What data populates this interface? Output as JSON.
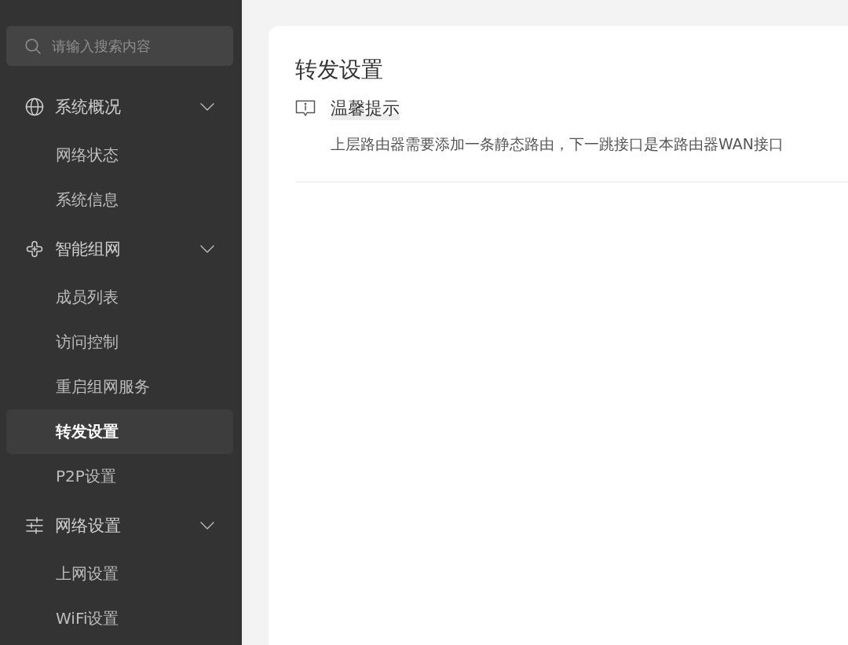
{
  "sidebar": {
    "search": {
      "placeholder": "请输入搜索内容"
    },
    "groups": [
      {
        "label": "系统概况",
        "expanded": true,
        "children": [
          {
            "label": "网络状态",
            "selected": false
          },
          {
            "label": "系统信息",
            "selected": false
          }
        ]
      },
      {
        "label": "智能组网",
        "expanded": true,
        "children": [
          {
            "label": "成员列表",
            "selected": false
          },
          {
            "label": "访问控制",
            "selected": false
          },
          {
            "label": "重启组网服务",
            "selected": false
          },
          {
            "label": "转发设置",
            "selected": true
          },
          {
            "label": "P2P设置",
            "selected": false
          }
        ]
      },
      {
        "label": "网络设置",
        "expanded": true,
        "children": [
          {
            "label": "上网设置",
            "selected": false
          },
          {
            "label": "WiFi设置",
            "selected": false
          }
        ]
      }
    ]
  },
  "page": {
    "title": "转发设置",
    "notice": {
      "title": "温馨提示",
      "text": "上层路由器需要添加一条静态路由，下一跳接口是本路由器WAN接口"
    }
  }
}
